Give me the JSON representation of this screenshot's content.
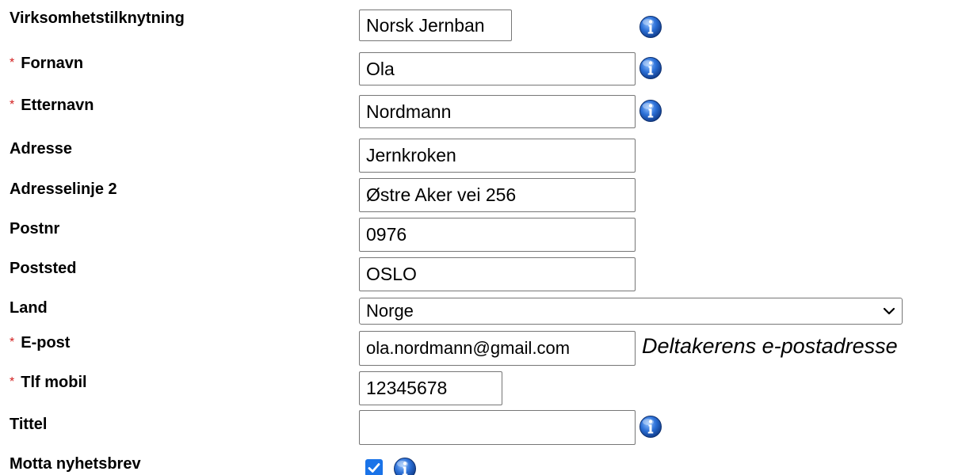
{
  "form": {
    "virksomhet": {
      "label": "Virksomhetstilknytning",
      "value": "Norsk Jernban"
    },
    "fornavn": {
      "required_marker": "*",
      "label": "Fornavn",
      "value": "Ola"
    },
    "etternavn": {
      "required_marker": "*",
      "label": "Etternavn",
      "value": "Nordmann"
    },
    "adresse": {
      "label": "Adresse",
      "value": "Jernkroken"
    },
    "adresselinje2": {
      "label": "Adresselinje 2",
      "value": "Østre Aker vei 256"
    },
    "postnr": {
      "label": "Postnr",
      "value": "0976"
    },
    "poststed": {
      "label": "Poststed",
      "value": "OSLO"
    },
    "land": {
      "label": "Land",
      "selected": "Norge"
    },
    "epost": {
      "required_marker": "*",
      "label": "E-post",
      "value": "ola.nordmann@gmail.com",
      "hint": "Deltakerens e-postadresse"
    },
    "tlf": {
      "required_marker": "*",
      "label": "Tlf mobil",
      "value": "12345678"
    },
    "tittel": {
      "label": "Tittel",
      "value": ""
    },
    "nyhetsbrev": {
      "label": "Motta nyhetsbrev",
      "checked": true
    }
  },
  "icons": {
    "info": "info-icon",
    "checkmark": "checkmark-icon",
    "dropdown": "chevron-down-icon"
  },
  "colors": {
    "required": "#d21f1f",
    "info_blue": "#2b6fd6",
    "checkbox_blue": "#1a73e8"
  }
}
